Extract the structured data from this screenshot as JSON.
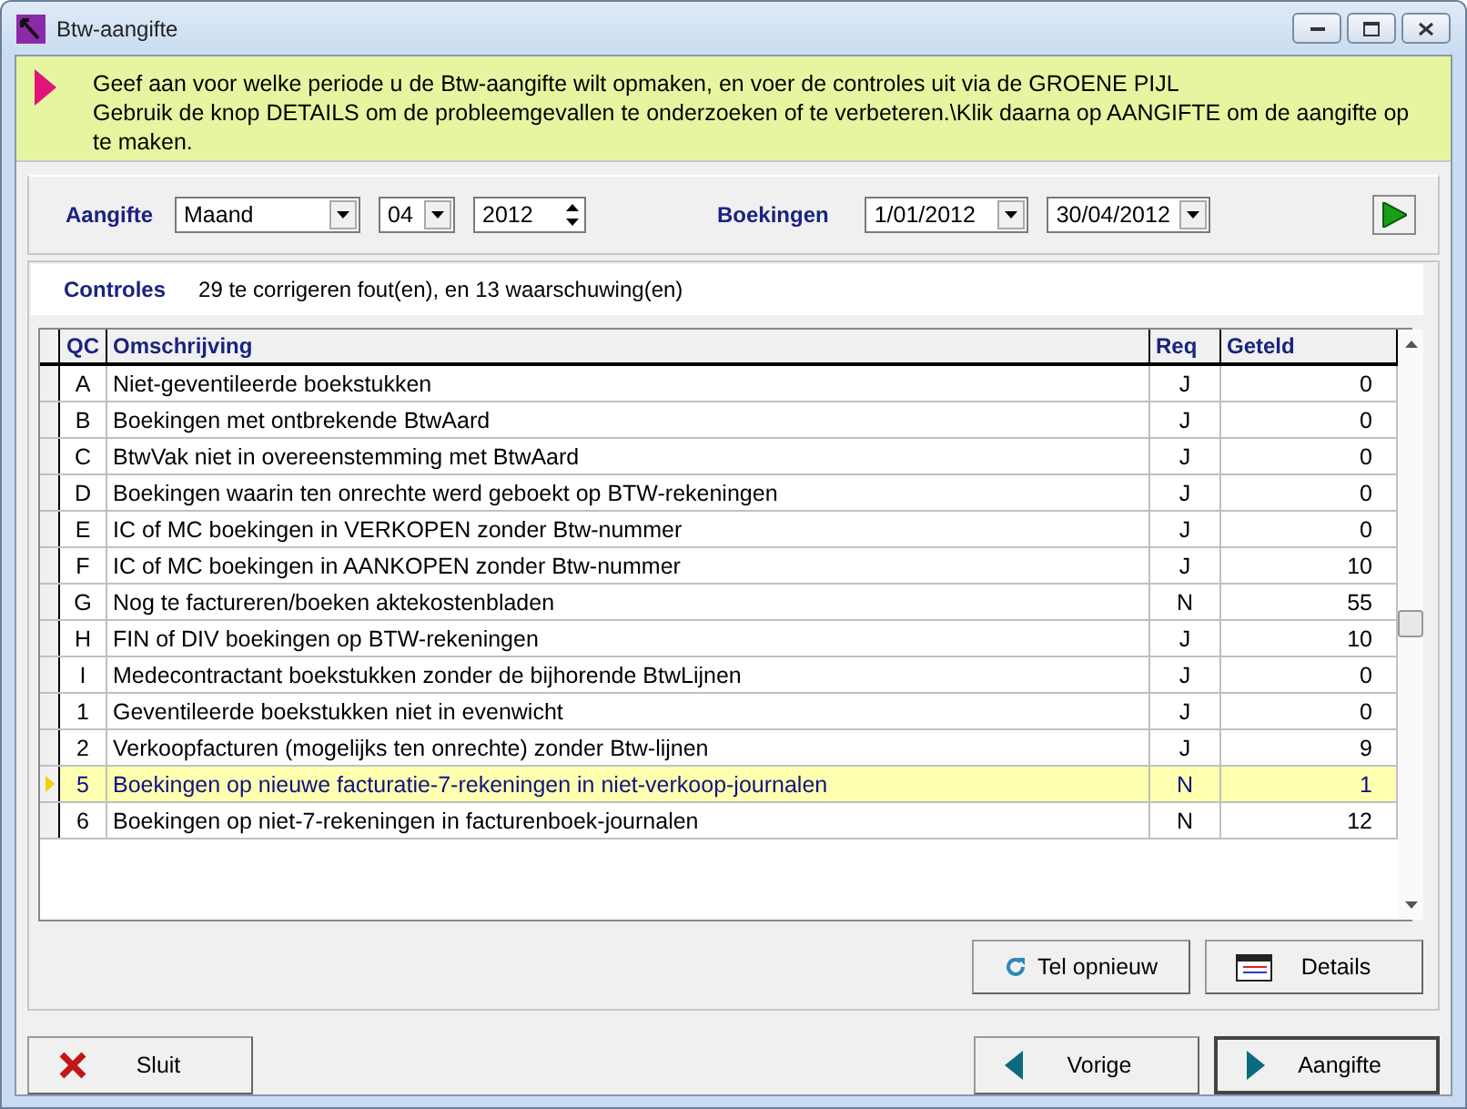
{
  "window": {
    "title": "Btw-aangifte"
  },
  "banner": {
    "lines": [
      "Geef aan voor welke periode u de Btw-aangifte wilt opmaken, en voer de controles uit via de GROENE PIJL",
      "Gebruik de knop DETAILS om de probleemgevallen te onderzoeken of te verbeteren.\\Klik daarna op AANGIFTE om de aangifte op te maken."
    ]
  },
  "filter": {
    "aangifte_label": "Aangifte",
    "period_type": "Maand",
    "month": "04",
    "year": "2012",
    "boekingen_label": "Boekingen",
    "date_from": "1/01/2012",
    "date_to": "30/04/2012"
  },
  "controles": {
    "label": "Controles",
    "summary": "29 te corrigeren fout(en), en 13 waarschuwing(en)"
  },
  "table": {
    "columns": [
      "QC",
      "Omschrijving",
      "Req",
      "Geteld"
    ],
    "rows": [
      {
        "qc": "A",
        "description": "Niet-geventileerde boekstukken",
        "req": "J",
        "count": "0",
        "selected": false
      },
      {
        "qc": "B",
        "description": "Boekingen met ontbrekende BtwAard",
        "req": "J",
        "count": "0",
        "selected": false
      },
      {
        "qc": "C",
        "description": "BtwVak niet in overeenstemming met BtwAard",
        "req": "J",
        "count": "0",
        "selected": false
      },
      {
        "qc": "D",
        "description": "Boekingen waarin ten onrechte werd geboekt op BTW-rekeningen",
        "req": "J",
        "count": "0",
        "selected": false
      },
      {
        "qc": "E",
        "description": "IC of MC boekingen in VERKOPEN zonder Btw-nummer",
        "req": "J",
        "count": "0",
        "selected": false
      },
      {
        "qc": "F",
        "description": "IC of MC boekingen in AANKOPEN zonder Btw-nummer",
        "req": "J",
        "count": "10",
        "selected": false
      },
      {
        "qc": "G",
        "description": "Nog te factureren/boeken aktekostenbladen",
        "req": "N",
        "count": "55",
        "selected": false
      },
      {
        "qc": "H",
        "description": "FIN of DIV boekingen op BTW-rekeningen",
        "req": "J",
        "count": "10",
        "selected": false
      },
      {
        "qc": "I",
        "description": "Medecontractant boekstukken zonder de bijhorende BtwLijnen",
        "req": "J",
        "count": "0",
        "selected": false
      },
      {
        "qc": "1",
        "description": "Geventileerde boekstukken niet in evenwicht",
        "req": "J",
        "count": "0",
        "selected": false
      },
      {
        "qc": "2",
        "description": "Verkoopfacturen (mogelijks ten onrechte) zonder Btw-lijnen",
        "req": "J",
        "count": "9",
        "selected": false
      },
      {
        "qc": "5",
        "description": "Boekingen op nieuwe facturatie-7-rekeningen in niet-verkoop-journalen",
        "req": "N",
        "count": "1",
        "selected": true
      },
      {
        "qc": "6",
        "description": "Boekingen op niet-7-rekeningen in facturenboek-journalen",
        "req": "N",
        "count": "12",
        "selected": false
      }
    ]
  },
  "panel_buttons": [
    {
      "kind": "recount",
      "label": "Tel opnieuw"
    },
    {
      "kind": "details",
      "label": "Details"
    }
  ],
  "footer_buttons": [
    {
      "kind": "close",
      "label": "Sluit"
    },
    {
      "kind": "back",
      "label": "Vorige"
    },
    {
      "kind": "next",
      "label": "Aangifte"
    }
  ]
}
